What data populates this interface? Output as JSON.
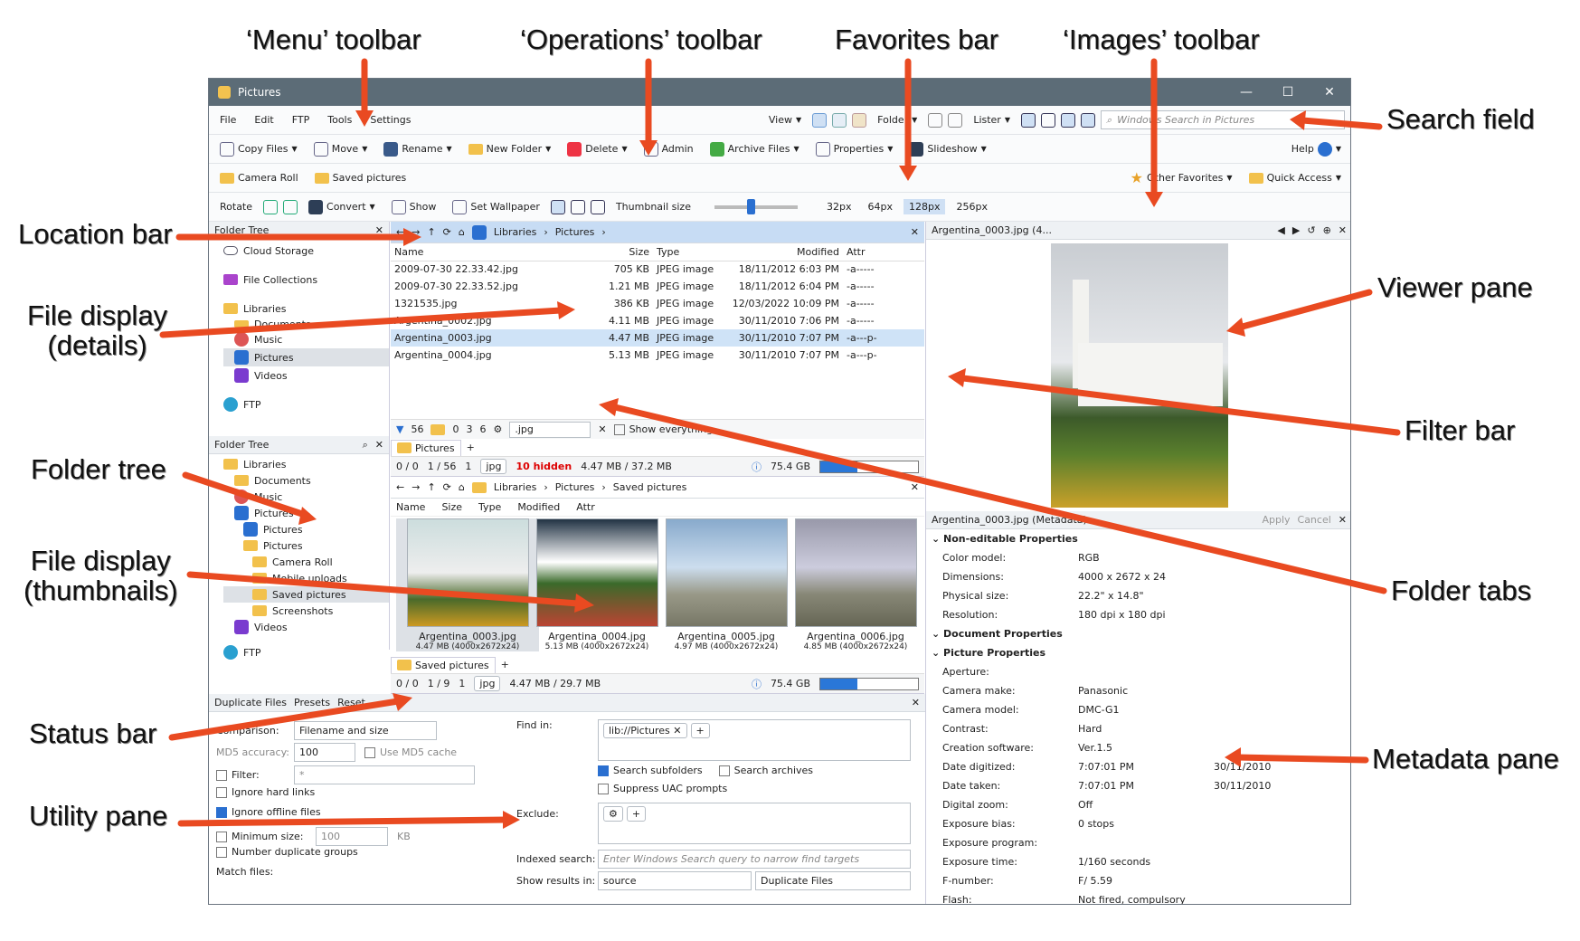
{
  "annotations": {
    "menu": "‘Menu’ toolbar",
    "operations": "‘Operations’ toolbar",
    "favorites": "Favorites bar",
    "images": "‘Images’ toolbar",
    "search": "Search field",
    "location": "Location bar",
    "details": "File display\n(details)",
    "viewer": "Viewer pane",
    "tree": "Folder tree",
    "filter": "Filter bar",
    "thumbs": "File display\n(thumbnails)",
    "tabs": "Folder tabs",
    "status": "Status bar",
    "metadata": "Metadata pane",
    "utility": "Utility pane"
  },
  "window": {
    "title": "Pictures",
    "min": "—",
    "max": "☐",
    "close": "✕"
  },
  "menu": [
    "File",
    "Edit",
    "FTP",
    "Tools",
    "Settings"
  ],
  "views": {
    "view": "View",
    "folder": "Folder",
    "lister": "Lister",
    "search_placeholder": "Windows Search in Pictures"
  },
  "ops": {
    "copy": "Copy Files",
    "move": "Move",
    "rename": "Rename",
    "newfolder": "New Folder",
    "delete": "Delete",
    "admin": "Admin",
    "archive": "Archive Files",
    "props": "Properties",
    "slideshow": "Slideshow",
    "help": "Help"
  },
  "fav": {
    "a": "Camera Roll",
    "b": "Saved pictures",
    "other": "Other Favorites",
    "quick": "Quick Access"
  },
  "img": {
    "rotate": "Rotate",
    "convert": "Convert",
    "show": "Show",
    "wallpaper": "Set Wallpaper",
    "thumb": "Thumbnail size",
    "s1": "32px",
    "s2": "64px",
    "s3": "128px",
    "s4": "256px"
  },
  "tree1": {
    "title": "Folder Tree",
    "items": [
      "Cloud Storage",
      "File Collections",
      "Libraries",
      "Documents",
      "Music",
      "Pictures",
      "Videos",
      "FTP"
    ]
  },
  "tree2": {
    "title": "Folder Tree",
    "items": [
      "Libraries",
      "Documents",
      "Music",
      "Pictures",
      "Pictures",
      "Pictures",
      "Camera Roll",
      "Mobile uploads",
      "Saved pictures",
      "Screenshots",
      "Videos",
      "FTP"
    ]
  },
  "lister1": {
    "crumbs": [
      "Libraries",
      "Pictures"
    ],
    "cols": [
      "Name",
      "Size",
      "Type",
      "Modified",
      "Attr"
    ],
    "rows": [
      [
        "2009-07-30 22.33.42.jpg",
        "705 KB",
        "JPEG image",
        "18/11/2012",
        "6:03 PM",
        "-a-----"
      ],
      [
        "2009-07-30 22.33.52.jpg",
        "1.21 MB",
        "JPEG image",
        "18/11/2012",
        "6:04 PM",
        "-a-----"
      ],
      [
        "1321535.jpg",
        "386 KB",
        "JPEG image",
        "12/03/2022",
        "10:09 PM",
        "-a-----"
      ],
      [
        "Argentina_0002.jpg",
        "4.11 MB",
        "JPEG image",
        "30/11/2010",
        "7:06 PM",
        "-a-----"
      ],
      [
        "Argentina_0003.jpg",
        "4.47 MB",
        "JPEG image",
        "30/11/2010",
        "7:07 PM",
        "-a---p-"
      ],
      [
        "Argentina_0004.jpg",
        "5.13 MB",
        "JPEG image",
        "30/11/2010",
        "7:07 PM",
        "-a---p-"
      ]
    ],
    "filter": {
      "n1": "56",
      "n2": "0",
      "n3": "3",
      "n4": "6",
      "ext": ".jpg",
      "showall": "Show everything"
    },
    "tab": "Pictures",
    "status": {
      "a": "0 / 0",
      "b": "1 / 56",
      "c": "1",
      "d": "jpg",
      "hidden": "10 hidden",
      "size": "4.47 MB / 37.2 MB",
      "free": "75.4 GB",
      "used": 0.38
    }
  },
  "lister2": {
    "crumbs": [
      "Libraries",
      "Pictures",
      "Saved pictures"
    ],
    "cols": [
      "Name",
      "Size",
      "Type",
      "Modified",
      "Attr"
    ],
    "thumbs": [
      {
        "name": "Argentina_0003.jpg",
        "info": "4.47 MB (4000x2672x24)"
      },
      {
        "name": "Argentina_0004.jpg",
        "info": "5.13 MB (4000x2672x24)"
      },
      {
        "name": "Argentina_0005.jpg",
        "info": "4.97 MB (4000x2672x24)"
      },
      {
        "name": "Argentina_0006.jpg",
        "info": "4.85 MB (4000x2672x24)"
      }
    ],
    "tab": "Saved pictures",
    "status": {
      "a": "0 / 0",
      "b": "1 / 9",
      "c": "1",
      "d": "jpg",
      "size": "4.47 MB / 29.7 MB",
      "free": "75.4 GB",
      "used": 0.38
    }
  },
  "viewer": {
    "title": "Argentina_0003.jpg (4..."
  },
  "metadata": {
    "title": "Argentina_0003.jpg (Metadata)",
    "apply": "Apply",
    "cancel": "Cancel",
    "sec1": "Non-editable Properties",
    "rows1": [
      [
        "Color model:",
        "RGB",
        ""
      ],
      [
        "Dimensions:",
        "4000 x 2672 x 24",
        ""
      ],
      [
        "Physical size:",
        "22.2\" x 14.8\"",
        ""
      ],
      [
        "Resolution:",
        "180 dpi x 180 dpi",
        ""
      ]
    ],
    "sec2": "Document Properties",
    "sec3": "Picture Properties",
    "rows3": [
      [
        "Aperture:",
        "",
        ""
      ],
      [
        "Camera make:",
        "Panasonic",
        ""
      ],
      [
        "Camera model:",
        "DMC-G1",
        ""
      ],
      [
        "Contrast:",
        "Hard",
        ""
      ],
      [
        "Creation software:",
        "Ver.1.5",
        ""
      ],
      [
        "Date digitized:",
        "7:07:01 PM",
        "30/11/2010"
      ],
      [
        "Date taken:",
        "7:07:01 PM",
        "30/11/2010"
      ],
      [
        "Digital zoom:",
        "Off",
        ""
      ],
      [
        "Exposure bias:",
        "0     stops",
        ""
      ],
      [
        "Exposure program:",
        "",
        ""
      ],
      [
        "Exposure time:",
        "1/160      seconds",
        ""
      ],
      [
        "F-number:",
        "F/  5.59",
        ""
      ],
      [
        "Flash:",
        "Not fired, compulsory",
        ""
      ]
    ]
  },
  "utility": {
    "title": "Duplicate Files",
    "presets": "Presets",
    "reset": "Reset",
    "comparison_l": "Comparison:",
    "comparison": "Filename and size",
    "md5_l": "MD5 accuracy:",
    "md5": "100",
    "md5cache": "Use MD5 cache",
    "filter_l": "Filter:",
    "filter": "*",
    "hard": "Ignore hard links",
    "offline": "Ignore offline files",
    "minsize": "Minimum size:",
    "minval": "100",
    "kb": "KB",
    "numdup": "Number duplicate groups",
    "match": "Match files:",
    "findin": "Find in:",
    "path": "lib://Pictures",
    "subf": "Search subfolders",
    "arch": "Search archives",
    "uac": "Suppress UAC prompts",
    "exclude": "Exclude:",
    "indexed": "Indexed search:",
    "indexed_ph": "Enter Windows Search query to narrow find targets",
    "showres": "Show results in:",
    "src": "source",
    "dup": "Duplicate Files"
  }
}
